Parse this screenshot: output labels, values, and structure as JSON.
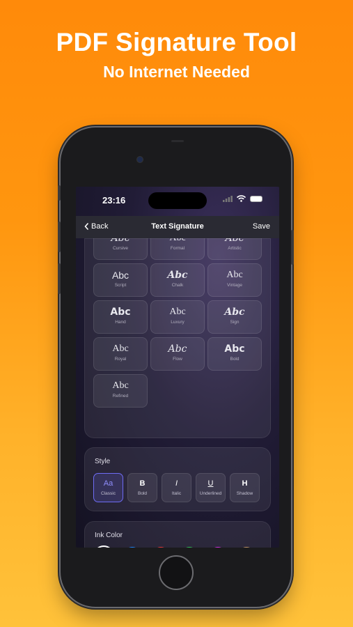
{
  "promo": {
    "title": "PDF Signature Tool",
    "subtitle": "No Internet Needed"
  },
  "status_bar": {
    "time": "23:16"
  },
  "nav": {
    "back_label": "Back",
    "title": "Text Signature",
    "save_label": "Save"
  },
  "fonts": [
    {
      "sample": "Abc",
      "name": "Cursive"
    },
    {
      "sample": "Abc",
      "name": "Formal"
    },
    {
      "sample": "Abc",
      "name": "Artistic"
    },
    {
      "sample": "Abc",
      "name": "Script"
    },
    {
      "sample": "Abc",
      "name": "Chalk"
    },
    {
      "sample": "Abc",
      "name": "Vintage"
    },
    {
      "sample": "Abc",
      "name": "Hand"
    },
    {
      "sample": "Abc",
      "name": "Luxury"
    },
    {
      "sample": "Abc",
      "name": "Sign"
    },
    {
      "sample": "Abc",
      "name": "Royal"
    },
    {
      "sample": "Abc",
      "name": "Flow"
    },
    {
      "sample": "Abc",
      "name": "Bold"
    },
    {
      "sample": "Abc",
      "name": "Refined"
    }
  ],
  "style": {
    "label": "Style",
    "options": [
      {
        "glyph": "Aa",
        "label": "Classic",
        "active": true
      },
      {
        "glyph": "B",
        "label": "Bold"
      },
      {
        "glyph": "I",
        "label": "Italic"
      },
      {
        "glyph": "U",
        "label": "Underlined"
      },
      {
        "glyph": "H",
        "label": "Shadow"
      }
    ]
  },
  "ink": {
    "label": "Ink Color",
    "colors": [
      {
        "name": "black",
        "hex": "#000000",
        "selected": true
      },
      {
        "name": "blue",
        "hex": "#1e88ff"
      },
      {
        "name": "red",
        "hex": "#ee3b3b"
      },
      {
        "name": "green",
        "hex": "#33c759"
      },
      {
        "name": "magenta",
        "hex": "#d92ee8"
      },
      {
        "name": "tan",
        "hex": "#c89a6a"
      }
    ]
  },
  "colors": {
    "accent": "#6e6cf5",
    "background_top": "#ff8a0a",
    "background_bottom": "#ffc23a"
  }
}
